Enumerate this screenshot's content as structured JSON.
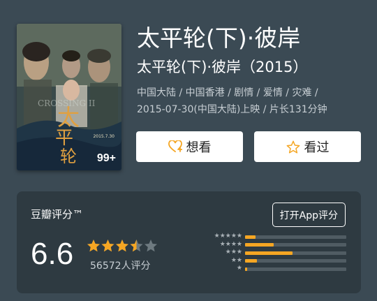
{
  "movie": {
    "title": "太平轮(下)·彼岸",
    "subtitle": "太平轮(下)·彼岸（2015）",
    "meta_line1": "中国大陆 / 中国香港 / 剧情 / 爱情 / 灾难 /",
    "meta_line2": "2015-07-30(中国大陆)上映 / 片长131分钟"
  },
  "poster": {
    "title_glyphs": "太平轮",
    "date_text": "2015.7.30",
    "badge": "99+"
  },
  "actions": {
    "want_label": "想看",
    "seen_label": "看过",
    "want_icon": "heart-plus-icon",
    "seen_icon": "star-outline-icon"
  },
  "rating": {
    "label": "豆瓣评分™",
    "open_app_label": "打开App评分",
    "score": "6.6",
    "count_text": "56572人评分",
    "stars_filled": 3.5,
    "distribution": [
      {
        "stars": "★★★★★",
        "fraction": 0.1
      },
      {
        "stars": "★★★★",
        "fraction": 0.28
      },
      {
        "stars": "★★★",
        "fraction": 0.47
      },
      {
        "stars": "★★",
        "fraction": 0.12
      },
      {
        "stars": "★",
        "fraction": 0.02
      }
    ]
  },
  "colors": {
    "background": "#3b4a54",
    "card": "#2e3a41",
    "star": "#f5a623",
    "star_empty": "#6e7a80"
  }
}
